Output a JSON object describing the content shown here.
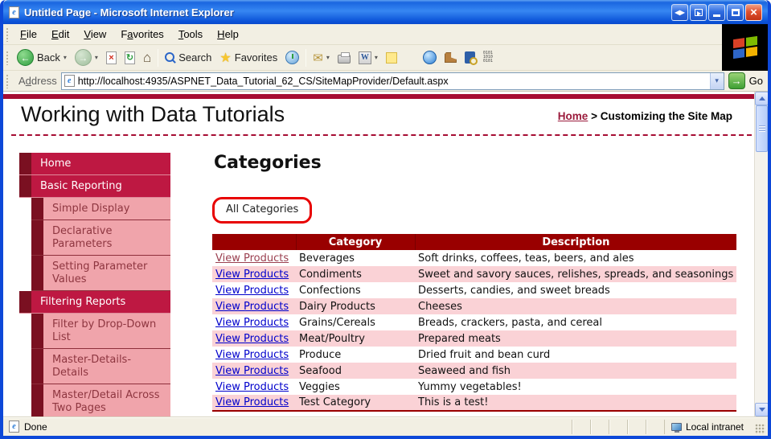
{
  "window": {
    "title": "Untitled Page - Microsoft Internet Explorer"
  },
  "menu": {
    "items": [
      {
        "id": "file",
        "pre": "",
        "accel": "F",
        "post": "ile"
      },
      {
        "id": "edit",
        "pre": "",
        "accel": "E",
        "post": "dit"
      },
      {
        "id": "view",
        "pre": "",
        "accel": "V",
        "post": "iew"
      },
      {
        "id": "favorites",
        "pre": "F",
        "accel": "a",
        "post": "vorites"
      },
      {
        "id": "tools",
        "pre": "",
        "accel": "T",
        "post": "ools"
      },
      {
        "id": "help",
        "pre": "",
        "accel": "H",
        "post": "elp"
      }
    ]
  },
  "toolbar": {
    "back": "Back",
    "search": "Search",
    "favorites": "Favorites"
  },
  "address": {
    "pre": "A",
    "accel": "d",
    "post": "dress",
    "url": "http://localhost:4935/ASPNET_Data_Tutorial_62_CS/SiteMapProvider/Default.aspx",
    "go": "Go"
  },
  "page": {
    "site_title": "Working with Data Tutorials",
    "breadcrumb": {
      "home": "Home",
      "separator": ">",
      "current": "Customizing the Site Map"
    },
    "sidebar": {
      "items": [
        {
          "label": "Home",
          "level": 0
        },
        {
          "label": "Basic Reporting",
          "level": 0
        },
        {
          "label": "Simple Display",
          "level": 1
        },
        {
          "label": "Declarative Parameters",
          "level": 1
        },
        {
          "label": "Setting Parameter Values",
          "level": 1
        },
        {
          "label": "Filtering Reports",
          "level": 0
        },
        {
          "label": "Filter by Drop-Down List",
          "level": 1
        },
        {
          "label": "Master-Details-Details",
          "level": 1
        },
        {
          "label": "Master/Detail Across Two Pages",
          "level": 1
        }
      ]
    },
    "main": {
      "heading": "Categories",
      "annotation_label": "All Categories",
      "table": {
        "columns": [
          "",
          "Category",
          "Description"
        ],
        "link_label": "View Products",
        "rows": [
          {
            "category": "Beverages",
            "description": "Soft drinks, coffees, teas, beers, and ales",
            "visited": true
          },
          {
            "category": "Condiments",
            "description": "Sweet and savory sauces, relishes, spreads, and seasonings"
          },
          {
            "category": "Confections",
            "description": "Desserts, candies, and sweet breads"
          },
          {
            "category": "Dairy Products",
            "description": "Cheeses"
          },
          {
            "category": "Grains/Cereals",
            "description": "Breads, crackers, pasta, and cereal"
          },
          {
            "category": "Meat/Poultry",
            "description": "Prepared meats"
          },
          {
            "category": "Produce",
            "description": "Dried fruit and bean curd"
          },
          {
            "category": "Seafood",
            "description": "Seaweed and fish"
          },
          {
            "category": "Veggies",
            "description": "Yummy vegetables!"
          },
          {
            "category": "Test Category",
            "description": "This is a test!"
          }
        ]
      }
    }
  },
  "status": {
    "left": "Done",
    "zone": "Local intranet"
  },
  "icons": {
    "ie_logo_e": "e",
    "back_arrow": "←",
    "forward_arrow": "→",
    "dropdown_caret": "▾",
    "stop_x": "×",
    "refresh": "↻",
    "home_house": "⌂",
    "favorites_star": "★",
    "mail_envelope": "✉",
    "word_w": "W",
    "go_arrow": "→",
    "close_x": "×",
    "window_arrows": "◀▶",
    "binary": "0101\n1010\n0101"
  },
  "colors": {
    "accent_crimson": "#BE1842",
    "nav_dark": "#7A1021",
    "nav_sub_bg": "#F0A4AB",
    "table_header_red": "#990000",
    "row_pink": "#FAD2D6",
    "annotation_red": "#E80000",
    "link_blue": "#0000CC",
    "link_visited": "#9B4050",
    "titlebar_blue": "#2E7FF0"
  }
}
